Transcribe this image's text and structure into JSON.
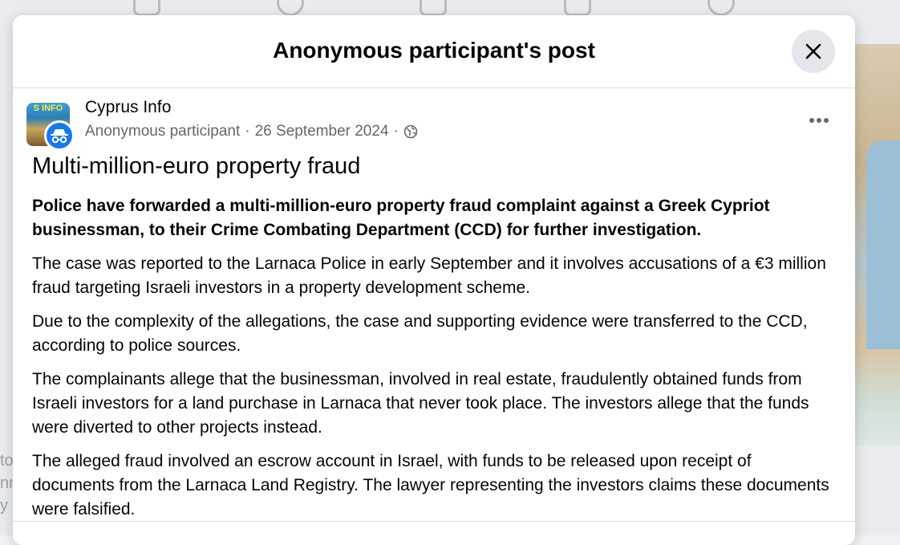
{
  "modal": {
    "title": "Anonymous participant's post"
  },
  "post": {
    "group_name": "Cyprus Info",
    "avatar_logo_text": "S INFO",
    "author": "Anonymous participant",
    "separator": "·",
    "date": "26 September 2024",
    "privacy_icon": "globe-icon",
    "title": "Multi-million-euro property fraud",
    "paragraphs": [
      "Police have forwarded a multi-million-euro property fraud complaint against a Greek Cypriot businessman, to their Crime Combating Department (CCD) for further investigation.",
      "The case was reported to the Larnaca Police in early September and it involves accusations of a €3 million fraud targeting Israeli investors in a property development scheme.",
      "Due to the complexity of the allegations, the case and supporting evidence were transferred to the CCD, according to police sources.",
      "The complainants allege that the businessman, involved in real estate, fraudulently obtained funds from Israeli investors for a land purchase in Larnaca that never took place. The investors allege that the funds were diverted to other projects instead.",
      "The alleged fraud involved an escrow account in Israel, with funds to be released upon receipt of documents from the Larnaca Land Registry. The lawyer representing the investors claims these documents were falsified."
    ]
  },
  "icons": {
    "close": "close-icon",
    "more": "more-options-icon",
    "anonymous": "anonymous-incognito-icon"
  },
  "background": {
    "left_text": "to\nnn\ny"
  },
  "colors": {
    "primary_text": "#050505",
    "secondary_text": "#65676b",
    "accent": "#1877f2",
    "close_bg": "#e4e6eb"
  }
}
